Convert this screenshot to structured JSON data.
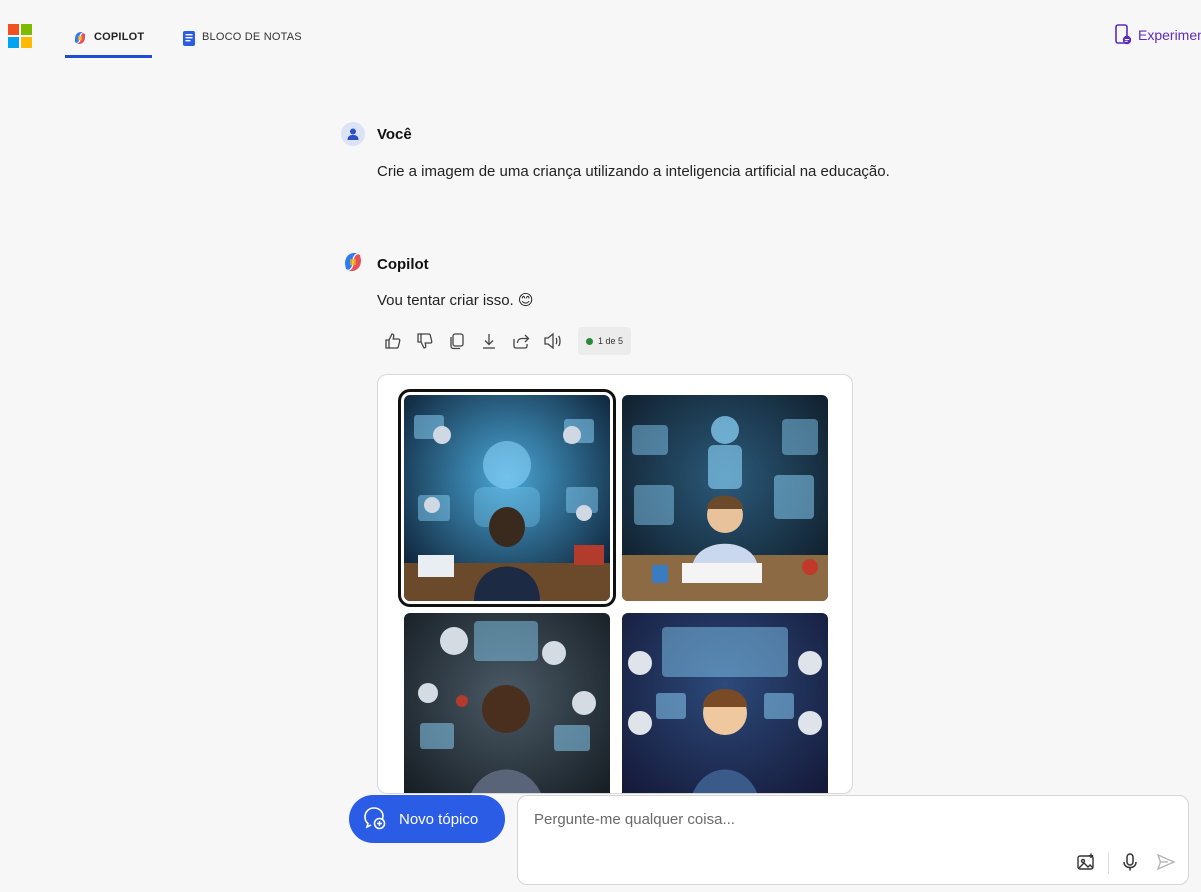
{
  "header": {
    "tabs": [
      {
        "label": "COPILOT",
        "icon": "copilot-icon",
        "active": true
      },
      {
        "label": "BLOCO DE NOTAS",
        "icon": "notebook-icon",
        "active": false
      }
    ],
    "experiment_label": "Experimen"
  },
  "conversation": {
    "user": {
      "name": "Você",
      "text": "Crie a imagem de uma criança utilizando a inteligencia artificial na educação."
    },
    "assistant": {
      "name": "Copilot",
      "text": "Vou tentar criar isso. 😊",
      "toolbar": {
        "icons": [
          "thumbs-up-icon",
          "thumbs-down-icon",
          "copy-icon",
          "download-icon",
          "share-icon",
          "speaker-icon"
        ],
        "counter_label": "1 de 5"
      },
      "images": {
        "count": 4,
        "selected_index": 0
      }
    }
  },
  "composer": {
    "new_topic_label": "Novo tópico",
    "placeholder": "Pergunte-me qualquer coisa..."
  },
  "colors": {
    "accent": "#2b5ce6",
    "tab_underline": "#1f4bd6",
    "experiment": "#5b2bbf",
    "status_dot": "#2a8a3a"
  }
}
